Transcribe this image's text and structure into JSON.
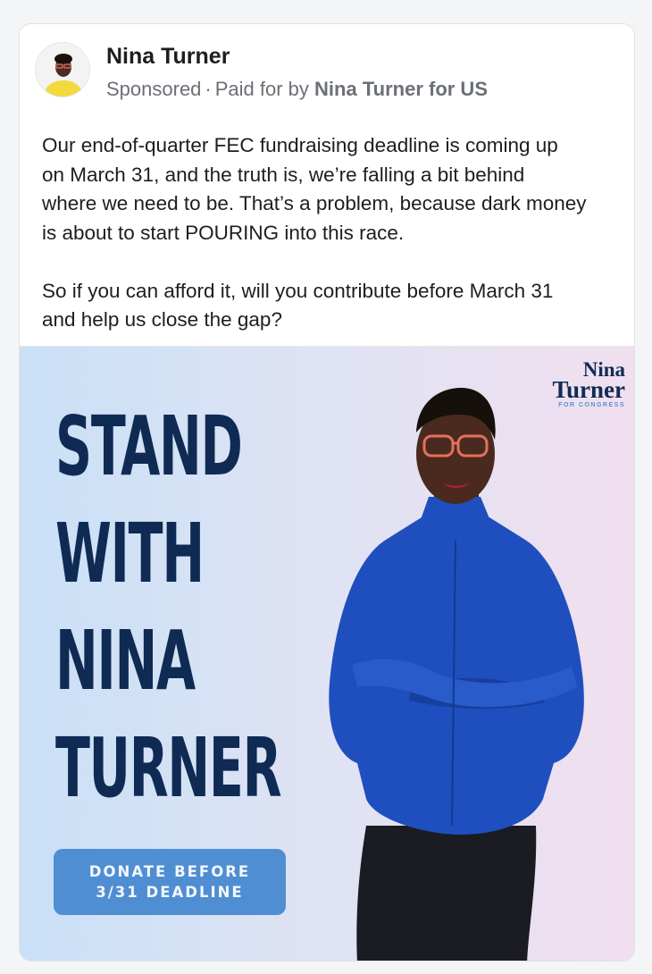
{
  "post": {
    "author": "Nina Turner",
    "sponsored_label": "Sponsored",
    "separator": "·",
    "paid_for_prefix": "Paid for by",
    "paid_for_name": "Nina Turner for US",
    "body": "Our end-of-quarter FEC fundraising deadline is coming up\non March 31, and the truth is, we’re falling a bit behind\nwhere we need to be. That’s a problem, because dark money\nis about to start POURING into this race.\n\nSo if you can afford it, will you contribute before March 31\nand help us close the gap?"
  },
  "creative": {
    "headline": [
      "STAND",
      "WITH",
      "NINA",
      "TURNER"
    ],
    "logo": {
      "line1": "Nina",
      "line2": "Turner",
      "line3": "FOR CONGRESS"
    },
    "cta": {
      "line1": "DONATE BEFORE",
      "line2": "3/31 DEADLINE"
    }
  },
  "colors": {
    "navy": "#0f2b54",
    "cta_blue": "#4f8ed2",
    "sweater_blue": "#1f4fbf",
    "bg_left": "#c9e0f6",
    "bg_right": "#f1dfee"
  },
  "icons": {
    "avatar": "profile-photo-avatar"
  }
}
